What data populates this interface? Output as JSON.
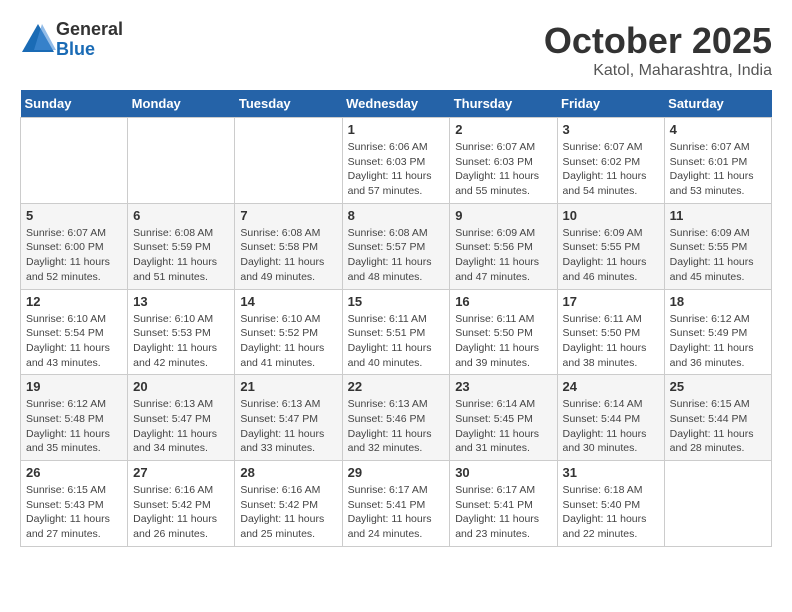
{
  "header": {
    "logo_line1": "General",
    "logo_line2": "Blue",
    "month": "October 2025",
    "location": "Katol, Maharashtra, India"
  },
  "weekdays": [
    "Sunday",
    "Monday",
    "Tuesday",
    "Wednesday",
    "Thursday",
    "Friday",
    "Saturday"
  ],
  "weeks": [
    [
      {
        "day": "",
        "info": ""
      },
      {
        "day": "",
        "info": ""
      },
      {
        "day": "",
        "info": ""
      },
      {
        "day": "1",
        "info": "Sunrise: 6:06 AM\nSunset: 6:03 PM\nDaylight: 11 hours\nand 57 minutes."
      },
      {
        "day": "2",
        "info": "Sunrise: 6:07 AM\nSunset: 6:03 PM\nDaylight: 11 hours\nand 55 minutes."
      },
      {
        "day": "3",
        "info": "Sunrise: 6:07 AM\nSunset: 6:02 PM\nDaylight: 11 hours\nand 54 minutes."
      },
      {
        "day": "4",
        "info": "Sunrise: 6:07 AM\nSunset: 6:01 PM\nDaylight: 11 hours\nand 53 minutes."
      }
    ],
    [
      {
        "day": "5",
        "info": "Sunrise: 6:07 AM\nSunset: 6:00 PM\nDaylight: 11 hours\nand 52 minutes."
      },
      {
        "day": "6",
        "info": "Sunrise: 6:08 AM\nSunset: 5:59 PM\nDaylight: 11 hours\nand 51 minutes."
      },
      {
        "day": "7",
        "info": "Sunrise: 6:08 AM\nSunset: 5:58 PM\nDaylight: 11 hours\nand 49 minutes."
      },
      {
        "day": "8",
        "info": "Sunrise: 6:08 AM\nSunset: 5:57 PM\nDaylight: 11 hours\nand 48 minutes."
      },
      {
        "day": "9",
        "info": "Sunrise: 6:09 AM\nSunset: 5:56 PM\nDaylight: 11 hours\nand 47 minutes."
      },
      {
        "day": "10",
        "info": "Sunrise: 6:09 AM\nSunset: 5:55 PM\nDaylight: 11 hours\nand 46 minutes."
      },
      {
        "day": "11",
        "info": "Sunrise: 6:09 AM\nSunset: 5:55 PM\nDaylight: 11 hours\nand 45 minutes."
      }
    ],
    [
      {
        "day": "12",
        "info": "Sunrise: 6:10 AM\nSunset: 5:54 PM\nDaylight: 11 hours\nand 43 minutes."
      },
      {
        "day": "13",
        "info": "Sunrise: 6:10 AM\nSunset: 5:53 PM\nDaylight: 11 hours\nand 42 minutes."
      },
      {
        "day": "14",
        "info": "Sunrise: 6:10 AM\nSunset: 5:52 PM\nDaylight: 11 hours\nand 41 minutes."
      },
      {
        "day": "15",
        "info": "Sunrise: 6:11 AM\nSunset: 5:51 PM\nDaylight: 11 hours\nand 40 minutes."
      },
      {
        "day": "16",
        "info": "Sunrise: 6:11 AM\nSunset: 5:50 PM\nDaylight: 11 hours\nand 39 minutes."
      },
      {
        "day": "17",
        "info": "Sunrise: 6:11 AM\nSunset: 5:50 PM\nDaylight: 11 hours\nand 38 minutes."
      },
      {
        "day": "18",
        "info": "Sunrise: 6:12 AM\nSunset: 5:49 PM\nDaylight: 11 hours\nand 36 minutes."
      }
    ],
    [
      {
        "day": "19",
        "info": "Sunrise: 6:12 AM\nSunset: 5:48 PM\nDaylight: 11 hours\nand 35 minutes."
      },
      {
        "day": "20",
        "info": "Sunrise: 6:13 AM\nSunset: 5:47 PM\nDaylight: 11 hours\nand 34 minutes."
      },
      {
        "day": "21",
        "info": "Sunrise: 6:13 AM\nSunset: 5:47 PM\nDaylight: 11 hours\nand 33 minutes."
      },
      {
        "day": "22",
        "info": "Sunrise: 6:13 AM\nSunset: 5:46 PM\nDaylight: 11 hours\nand 32 minutes."
      },
      {
        "day": "23",
        "info": "Sunrise: 6:14 AM\nSunset: 5:45 PM\nDaylight: 11 hours\nand 31 minutes."
      },
      {
        "day": "24",
        "info": "Sunrise: 6:14 AM\nSunset: 5:44 PM\nDaylight: 11 hours\nand 30 minutes."
      },
      {
        "day": "25",
        "info": "Sunrise: 6:15 AM\nSunset: 5:44 PM\nDaylight: 11 hours\nand 28 minutes."
      }
    ],
    [
      {
        "day": "26",
        "info": "Sunrise: 6:15 AM\nSunset: 5:43 PM\nDaylight: 11 hours\nand 27 minutes."
      },
      {
        "day": "27",
        "info": "Sunrise: 6:16 AM\nSunset: 5:42 PM\nDaylight: 11 hours\nand 26 minutes."
      },
      {
        "day": "28",
        "info": "Sunrise: 6:16 AM\nSunset: 5:42 PM\nDaylight: 11 hours\nand 25 minutes."
      },
      {
        "day": "29",
        "info": "Sunrise: 6:17 AM\nSunset: 5:41 PM\nDaylight: 11 hours\nand 24 minutes."
      },
      {
        "day": "30",
        "info": "Sunrise: 6:17 AM\nSunset: 5:41 PM\nDaylight: 11 hours\nand 23 minutes."
      },
      {
        "day": "31",
        "info": "Sunrise: 6:18 AM\nSunset: 5:40 PM\nDaylight: 11 hours\nand 22 minutes."
      },
      {
        "day": "",
        "info": ""
      }
    ]
  ]
}
